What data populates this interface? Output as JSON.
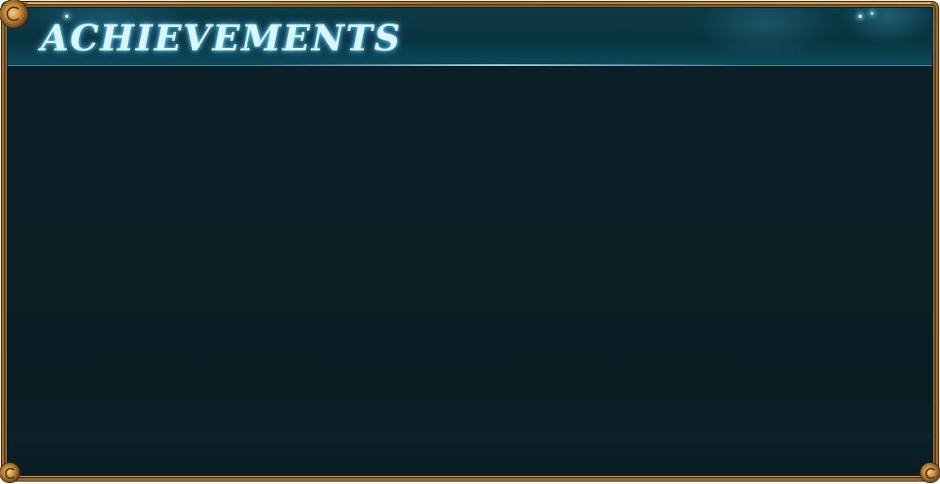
{
  "panel": {
    "title": "ACHIEVEMENTS"
  },
  "colors": {
    "frame_gold": "#9b6a2c",
    "header_bg": "#0d3947",
    "title_text": "#d9f6ff",
    "content_bg": "#0b1e24"
  },
  "icons": {
    "corner_ornament": "spiral-scroll-icon"
  }
}
